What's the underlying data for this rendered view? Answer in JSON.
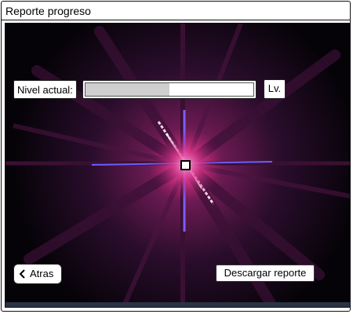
{
  "window": {
    "title": "Reporte progreso"
  },
  "level": {
    "label": "Nivel actual:",
    "progress_fraction": 0.5,
    "badge": "Lv."
  },
  "actions": {
    "back_label": "Atras",
    "download_label": "Descargar reporte"
  },
  "colors": {
    "background_glow": "#b0236a",
    "accent_ray": "#6b5cff"
  },
  "icons": {
    "back": "chevron-left-icon"
  }
}
